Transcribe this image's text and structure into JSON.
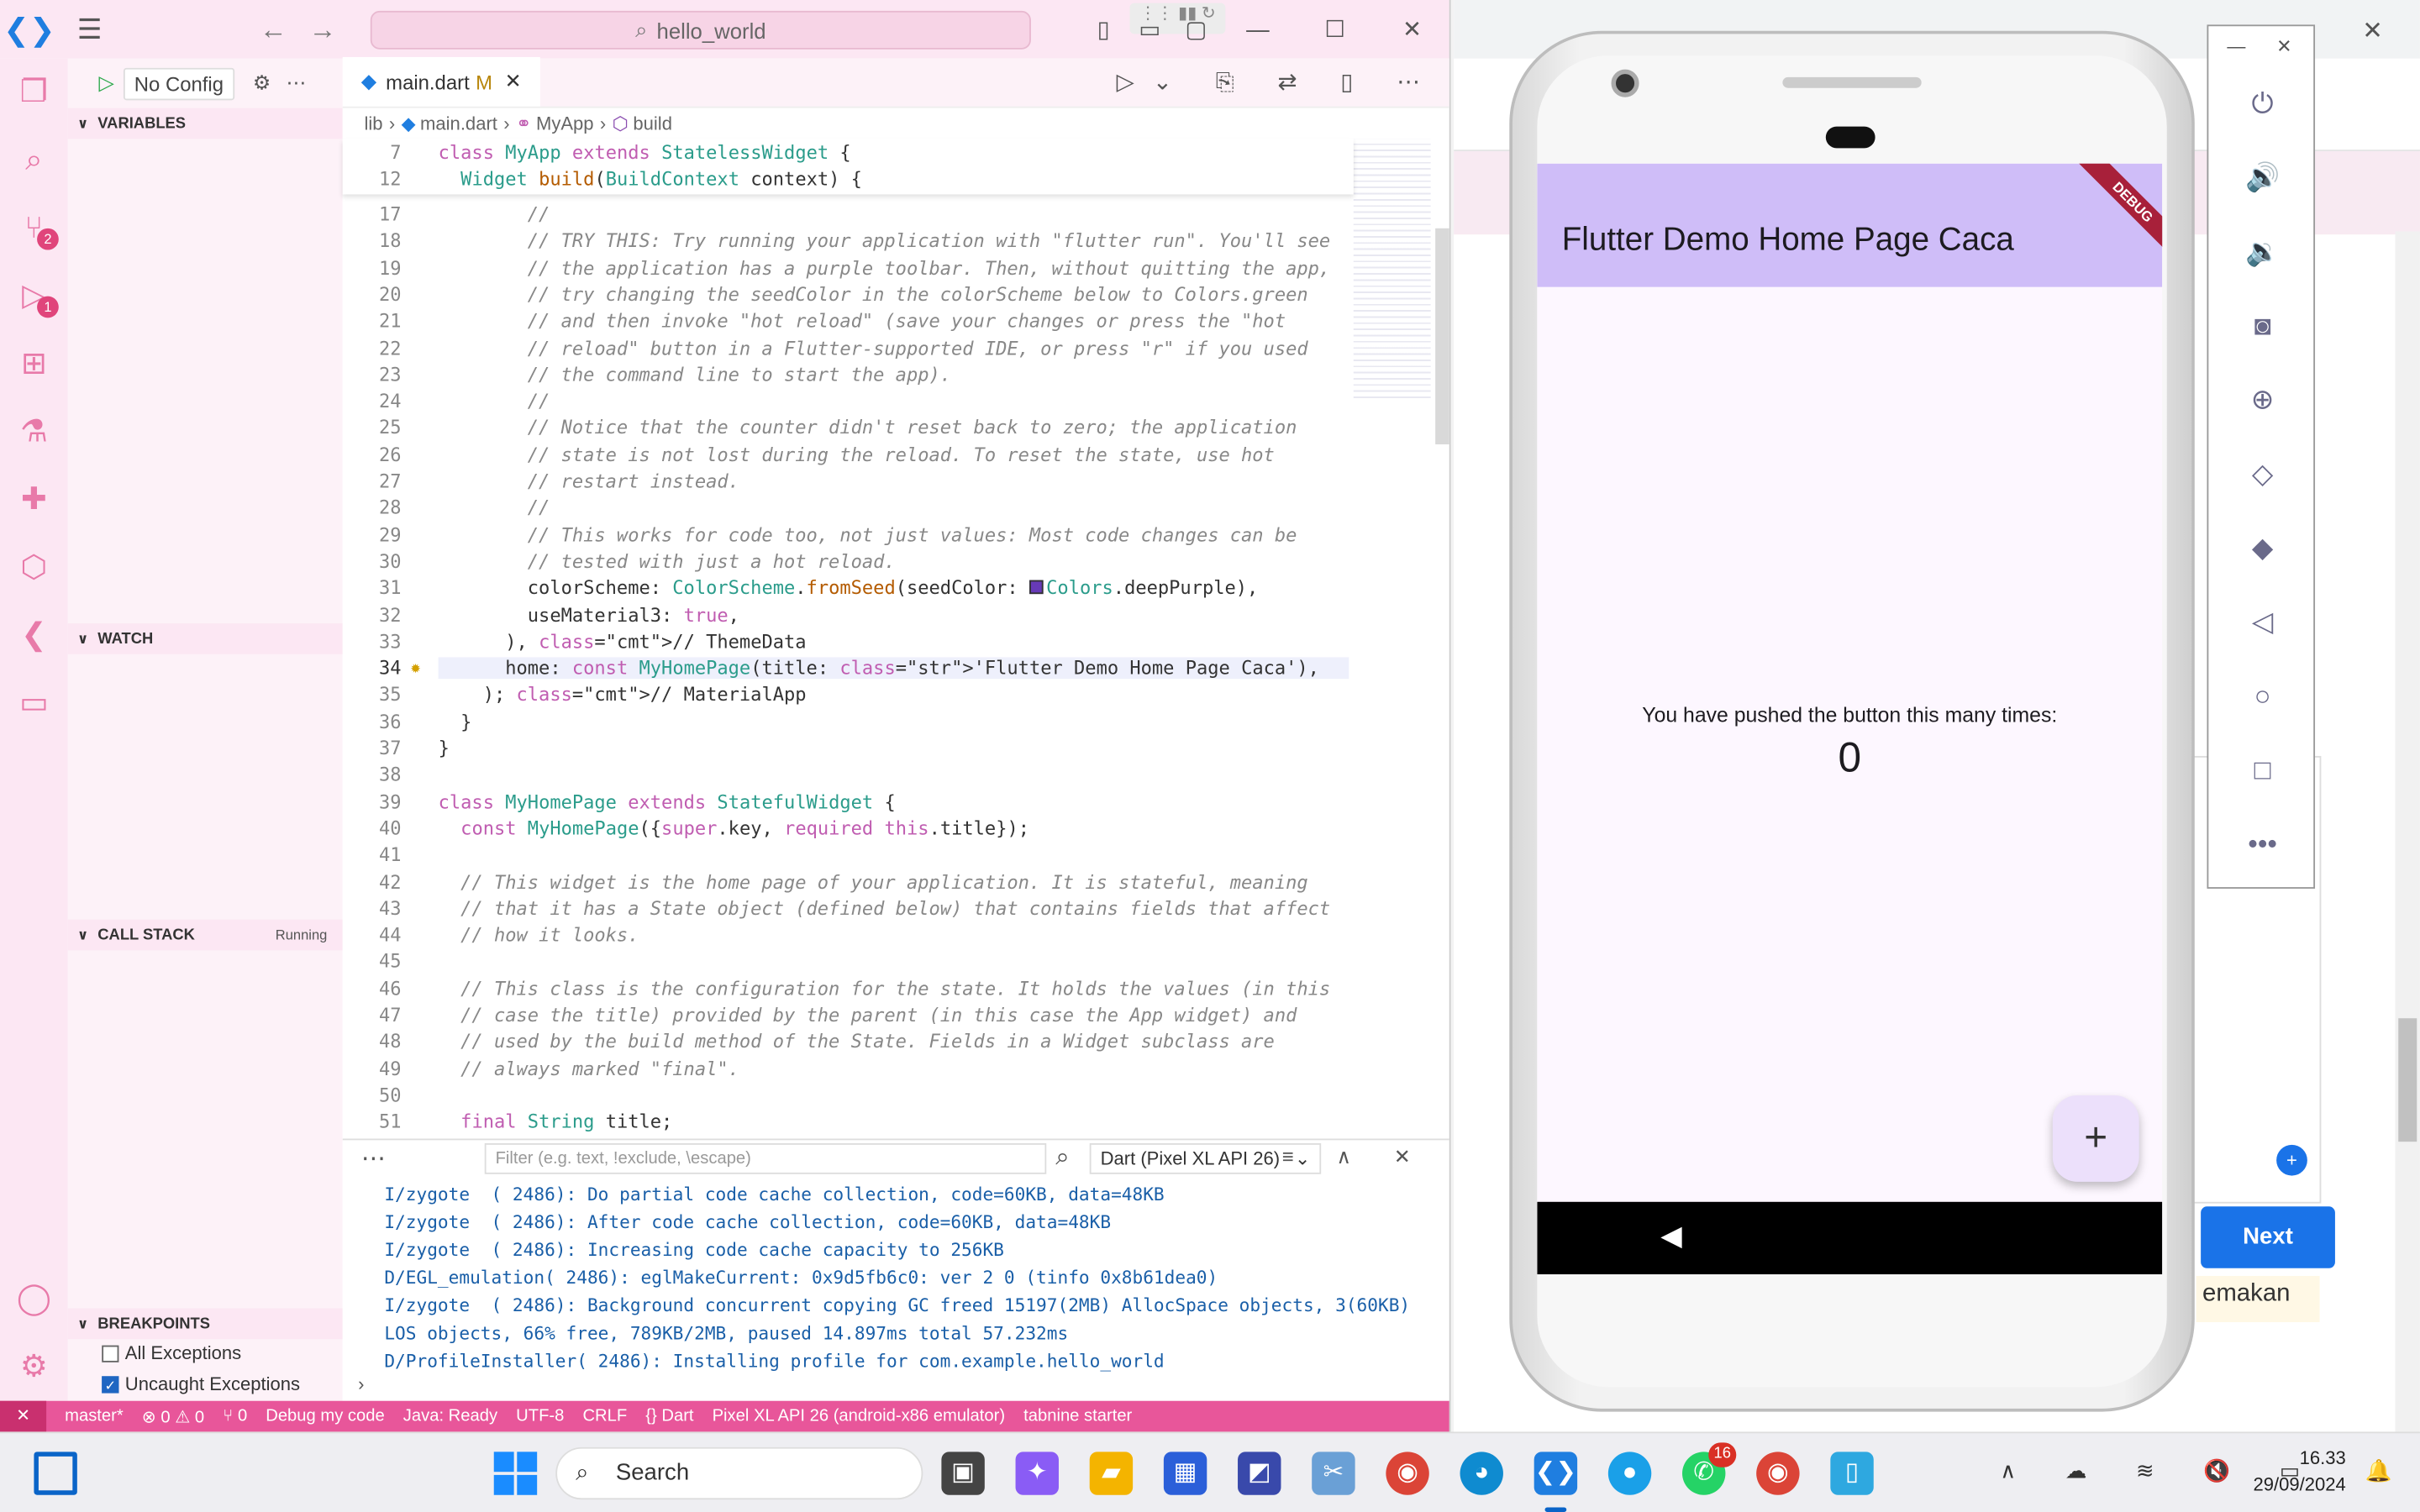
{
  "vscode": {
    "command_center": "hello_world",
    "sidebar": {
      "run_config": "No Config",
      "sections": {
        "variables": "VARIABLES",
        "watch": "WATCH",
        "call_stack": "CALL STACK",
        "call_stack_status": "Running",
        "breakpoints": "BREAKPOINTS"
      },
      "breakpoints": [
        {
          "label": "All Exceptions",
          "checked": false
        },
        {
          "label": "Uncaught Exceptions",
          "checked": true
        }
      ]
    },
    "activity_badges": {
      "source_control": "2",
      "run_debug": "1"
    },
    "tab": {
      "filename": "main.dart",
      "modified": "M"
    },
    "breadcrumb": [
      "lib",
      "main.dart",
      "MyApp",
      "build"
    ],
    "sticky": [
      {
        "line": "7",
        "text": "class MyApp extends StatelessWidget {"
      },
      {
        "line": "12",
        "text": "  Widget build(BuildContext context) {"
      }
    ],
    "code_lines": [
      {
        "n": "17",
        "t": "        //"
      },
      {
        "n": "18",
        "t": "        // TRY THIS: Try running your application with \"flutter run\". You'll see"
      },
      {
        "n": "19",
        "t": "        // the application has a purple toolbar. Then, without quitting the app,"
      },
      {
        "n": "20",
        "t": "        // try changing the seedColor in the colorScheme below to Colors.green"
      },
      {
        "n": "21",
        "t": "        // and then invoke \"hot reload\" (save your changes or press the \"hot"
      },
      {
        "n": "22",
        "t": "        // reload\" button in a Flutter-supported IDE, or press \"r\" if you used"
      },
      {
        "n": "23",
        "t": "        // the command line to start the app)."
      },
      {
        "n": "24",
        "t": "        //"
      },
      {
        "n": "25",
        "t": "        // Notice that the counter didn't reset back to zero; the application"
      },
      {
        "n": "26",
        "t": "        // state is not lost during the reload. To reset the state, use hot"
      },
      {
        "n": "27",
        "t": "        // restart instead."
      },
      {
        "n": "28",
        "t": "        //"
      },
      {
        "n": "29",
        "t": "        // This works for code too, not just values: Most code changes can be"
      },
      {
        "n": "30",
        "t": "        // tested with just a hot reload."
      },
      {
        "n": "31",
        "t": "        colorScheme: ColorScheme.fromSeed(seedColor: Colors.deepPurple),"
      },
      {
        "n": "32",
        "t": "        useMaterial3: true,"
      },
      {
        "n": "33",
        "t": "      ), // ThemeData"
      },
      {
        "n": "34",
        "t": "      home: const MyHomePage(title: 'Flutter Demo Home Page Caca'),"
      },
      {
        "n": "35",
        "t": "    ); // MaterialApp"
      },
      {
        "n": "36",
        "t": "  }"
      },
      {
        "n": "37",
        "t": "}"
      },
      {
        "n": "38",
        "t": ""
      },
      {
        "n": "39",
        "t": "class MyHomePage extends StatefulWidget {"
      },
      {
        "n": "40",
        "t": "  const MyHomePage({super.key, required this.title});"
      },
      {
        "n": "41",
        "t": ""
      },
      {
        "n": "42",
        "t": "  // This widget is the home page of your application. It is stateful, meaning"
      },
      {
        "n": "43",
        "t": "  // that it has a State object (defined below) that contains fields that affect"
      },
      {
        "n": "44",
        "t": "  // how it looks."
      },
      {
        "n": "45",
        "t": ""
      },
      {
        "n": "46",
        "t": "  // This class is the configuration for the state. It holds the values (in this"
      },
      {
        "n": "47",
        "t": "  // case the title) provided by the parent (in this case the App widget) and"
      },
      {
        "n": "48",
        "t": "  // used by the build method of the State. Fields in a Widget subclass are"
      },
      {
        "n": "49",
        "t": "  // always marked \"final\"."
      },
      {
        "n": "50",
        "t": ""
      },
      {
        "n": "51",
        "t": "  final String title;"
      }
    ],
    "panel": {
      "filter_placeholder": "Filter (e.g. text, !exclude, \\escape)",
      "output_channel": "Dart (Pixel XL API 26)",
      "log": [
        "I/zygote  ( 2486): Do partial code cache collection, code=60KB, data=48KB",
        "I/zygote  ( 2486): After code cache collection, code=60KB, data=48KB",
        "I/zygote  ( 2486): Increasing code cache capacity to 256KB",
        "D/EGL_emulation( 2486): eglMakeCurrent: 0x9d5fb6c0: ver 2 0 (tinfo 0x8b61dea0)",
        "I/zygote  ( 2486): Background concurrent copying GC freed 15197(2MB) AllocSpace objects, 3(60KB)",
        "LOS objects, 66% free, 789KB/2MB, paused 14.897ms total 57.232ms",
        "D/ProfileInstaller( 2486): Installing profile for com.example.hello_world"
      ]
    },
    "status": [
      "master*",
      "⊗ 0 ⚠ 0",
      "⑂ 0",
      "Debug my code",
      "Java: Ready",
      "UTF-8",
      "CRLF",
      "{} Dart",
      "Pixel XL API 26 (android-x86 emulator)",
      "tabnine starter"
    ]
  },
  "emulator": {
    "app_title": "Flutter Demo Home Page Caca",
    "debug_banner": "DEBUG",
    "counter_label": "You have pushed the button this many times:",
    "counter_value": "0",
    "fab_icon": "+"
  },
  "browser": {
    "next_button": "Next",
    "snippet_text": "emakan"
  },
  "taskbar": {
    "search": "Search",
    "whatsapp_badge": "16",
    "time": "16.33",
    "date": "29/09/2024"
  },
  "colors": {
    "accent": "#e8569a",
    "appbar": "#cfbdf8",
    "blue": "#1a73e8"
  }
}
